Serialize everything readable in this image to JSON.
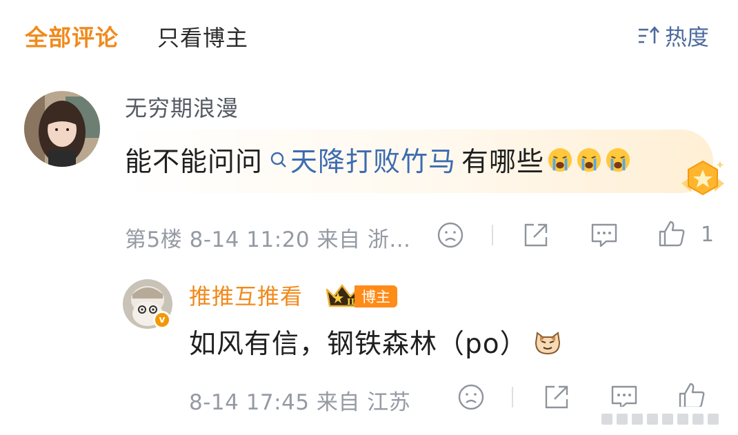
{
  "tabs": {
    "all_comments": "全部评论",
    "host_only": "只看博主"
  },
  "sort": {
    "label": "热度",
    "icon": "sort-icon"
  },
  "comment": {
    "username": "无穷期浪漫",
    "text_before": "能不能问问",
    "topic": "天降打败竹马",
    "text_after": "有哪些",
    "emoji": "crying-emoji",
    "floor": "第5楼",
    "time": "8-14 11:20",
    "source": "来自 浙...",
    "like_count": "1"
  },
  "reply": {
    "username": "推推互推看",
    "badge": "博主",
    "text": "如风有信，钢铁森林（po）",
    "emoji": "cat-emoji",
    "time": "8-14 17:45",
    "source": "来自 江苏"
  },
  "colors": {
    "accent": "#f08a1c",
    "topic": "#3d6bb0",
    "meta": "#959aa3"
  }
}
